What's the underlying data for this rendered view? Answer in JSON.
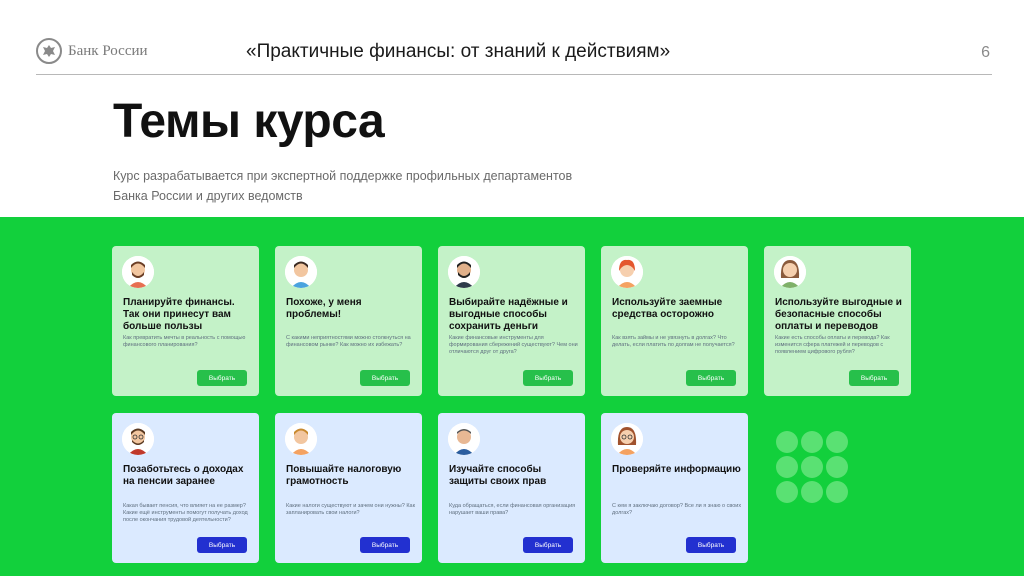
{
  "header": {
    "logo_text": "Банк России",
    "deck_title": "«Практичные финансы: от знаний к действиям»",
    "page_number": "6"
  },
  "main": {
    "title": "Темы курса",
    "subtitle_line1": "Курс разрабатывается при экспертной поддержке профильных департаментов",
    "subtitle_line2": "Банка России и других ведомств"
  },
  "colors": {
    "accent_green": "#12d03c",
    "card_green": "#c4f2c8",
    "card_blue": "#dbeaff",
    "button_green": "#27c04b",
    "button_blue": "#2230d0"
  },
  "cards": [
    {
      "title": "Планируйте финансы. Так они принесут вам больше пользы",
      "description": "Как превратить мечты в реальность с помощью финансового планирования?",
      "button": "Выбрать",
      "avatar_icon": "man-beard-avatar-icon"
    },
    {
      "title": "Похоже, у меня проблемы!",
      "description": "С какими неприятностями можно столкнуться на финансовом рынке? Как можно их избежать?",
      "button": "Выбрать",
      "avatar_icon": "man-avatar-icon"
    },
    {
      "title": "Выбирайте надёжные и выгодные способы сохранить деньги",
      "description": "Какие финансовые инструменты для формирования сбережений существуют? Чем они отличаются друг от друга?",
      "button": "Выбрать",
      "avatar_icon": "man-dark-beard-avatar-icon"
    },
    {
      "title": "Используйте заемные средства осторожно",
      "description": "Как взять займы и не увязнуть в долгах? Что делать, если платить по долгам не получается?",
      "button": "Выбрать",
      "avatar_icon": "woman-redhead-avatar-icon"
    },
    {
      "title": "Используйте выгодные и безопасные способы оплаты и переводов",
      "description": "Какие есть способы оплаты и перевода? Как изменится сфера платежей и переводов с появлением цифрового рубля?",
      "button": "Выбрать",
      "avatar_icon": "woman-avatar-icon"
    },
    {
      "title": "Позаботьтесь о доходах на пенсии заранее",
      "description": "Какая бывает пенсия, что влияет на ее размер? Какие ещё инструменты помогут получать доход после окончания трудовой деятельности?",
      "button": "Выбрать",
      "avatar_icon": "man-glasses-avatar-icon"
    },
    {
      "title": "Повышайте налоговую грамотность",
      "description": "Какие налоги существуют и зачем они нужны? Как запланировать свои налоги?",
      "button": "Выбрать",
      "avatar_icon": "man-blond-avatar-icon"
    },
    {
      "title": "Изучайте способы защиты своих прав",
      "description": "Куда обращаться, если финансовая организация нарушает ваши права?",
      "button": "Выбрать",
      "avatar_icon": "man-older-avatar-icon"
    },
    {
      "title": "Проверяйте информацию",
      "description": "С кем я заключаю договор? Все ли я знаю о своих долгах?",
      "button": "Выбрать",
      "avatar_icon": "woman-glasses-avatar-icon"
    }
  ]
}
